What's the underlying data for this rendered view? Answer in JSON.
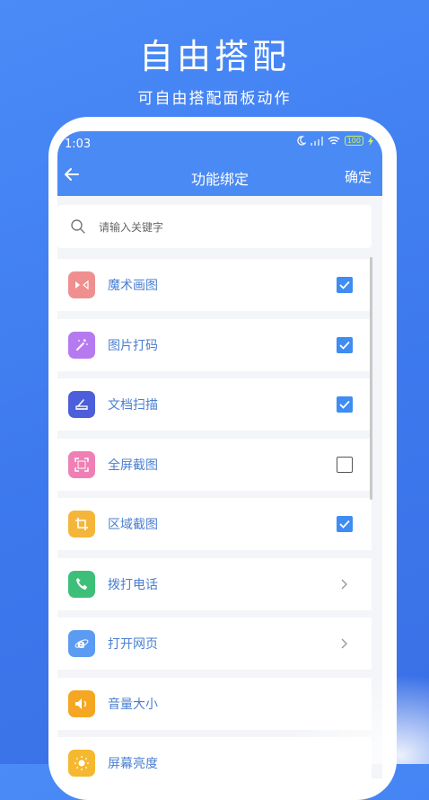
{
  "hero": {
    "title": "自由搭配",
    "subtitle": "可自由搭配面板动作"
  },
  "status_bar": {
    "time": "1:03",
    "battery": "100"
  },
  "app_bar": {
    "title": "功能绑定",
    "confirm_label": "确定"
  },
  "search": {
    "placeholder": "请输入关键字"
  },
  "items": [
    {
      "label": "魔术画图",
      "icon": "magic-draw-icon",
      "color": "#f08f8f",
      "control": "checkbox",
      "checked": true
    },
    {
      "label": "图片打码",
      "icon": "magic-wand-icon",
      "color": "#b57af0",
      "control": "checkbox",
      "checked": true
    },
    {
      "label": "文档扫描",
      "icon": "scanner-icon",
      "color": "#4c5ed9",
      "control": "checkbox",
      "checked": true
    },
    {
      "label": "全屏截图",
      "icon": "fullscreen-icon",
      "color": "#f07fb6",
      "control": "checkbox",
      "checked": false
    },
    {
      "label": "区域截图",
      "icon": "crop-icon",
      "color": "#f4b63a",
      "control": "checkbox",
      "checked": true
    },
    {
      "label": "拨打电话",
      "icon": "phone-icon",
      "color": "#3dbf7a",
      "control": "chevron"
    },
    {
      "label": "打开网页",
      "icon": "browser-icon",
      "color": "#5b9bf2",
      "control": "chevron"
    },
    {
      "label": "音量大小",
      "icon": "volume-icon",
      "color": "#f5a623",
      "control": "none"
    },
    {
      "label": "屏幕亮度",
      "icon": "brightness-icon",
      "color": "#f5b82e",
      "control": "none"
    }
  ]
}
